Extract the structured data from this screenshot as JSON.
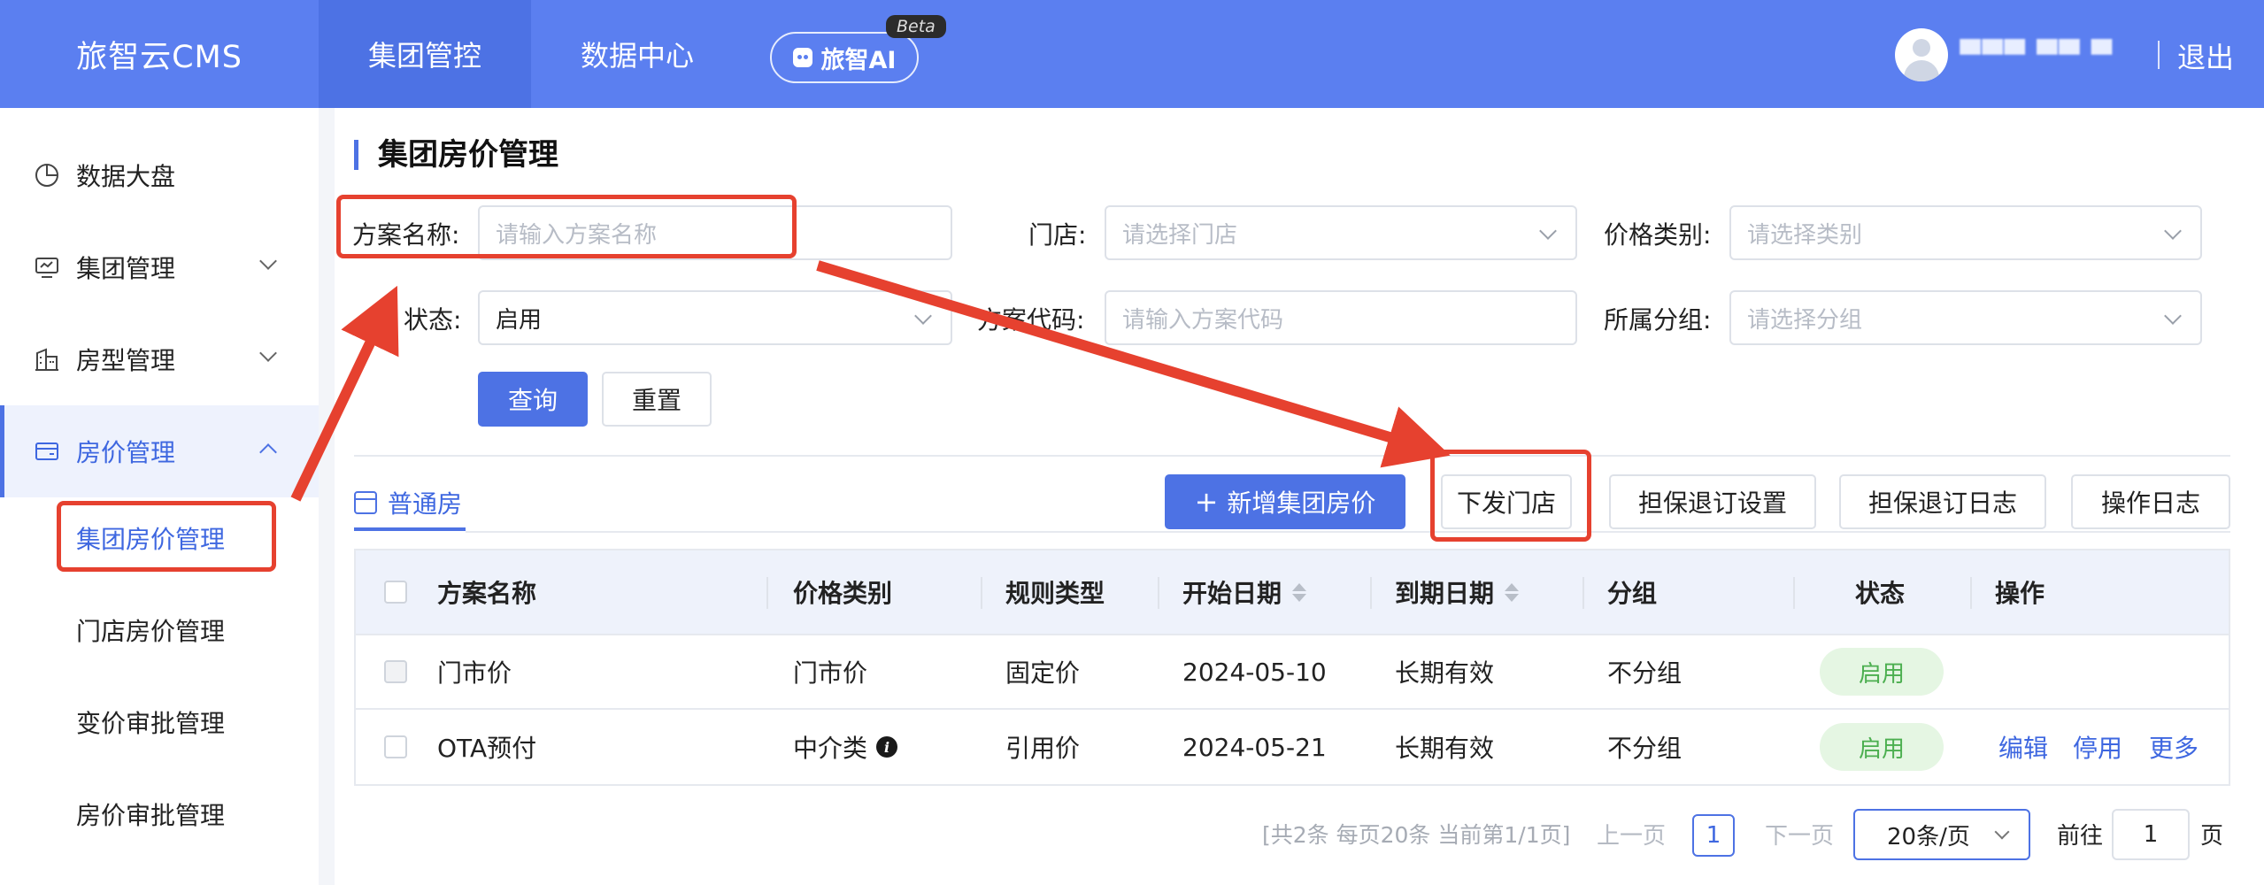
{
  "header": {
    "brand": "旅智云CMS",
    "nav": [
      {
        "label": "集团管控",
        "active": true
      },
      {
        "label": "数据中心",
        "active": false
      }
    ],
    "ai_button": "旅智AI",
    "ai_badge": "Beta",
    "username": "▀▀▀ ▀▀ ▀",
    "logout": "退出"
  },
  "sidebar": {
    "items": [
      {
        "label": "数据大盘",
        "icon": "pie-chart-icon"
      },
      {
        "label": "集团管理",
        "icon": "monitor-icon"
      },
      {
        "label": "房型管理",
        "icon": "building-icon"
      },
      {
        "label": "房价管理",
        "icon": "wallet-icon"
      }
    ],
    "sub_items": [
      {
        "label": "集团房价管理",
        "active": true
      },
      {
        "label": "门店房价管理"
      },
      {
        "label": "变价审批管理"
      },
      {
        "label": "房价审批管理"
      }
    ]
  },
  "page": {
    "title": "集团房价管理"
  },
  "filters": {
    "plan_name": {
      "label": "方案名称:",
      "placeholder": "请输入方案名称"
    },
    "store": {
      "label": "门店:",
      "placeholder": "请选择门店"
    },
    "price_type": {
      "label": "价格类别:",
      "placeholder": "请选择类别"
    },
    "status": {
      "label": "状态:",
      "value": "启用"
    },
    "plan_code": {
      "label": "方案代码:",
      "placeholder": "请输入方案代码"
    },
    "group": {
      "label": "所属分组:",
      "placeholder": "请选择分组"
    },
    "search_button": "查询",
    "reset_button": "重置"
  },
  "toolbar": {
    "tab": "普通房",
    "add_button": "新增集团房价",
    "dispatch_button": "下发门店",
    "guarantee_settings_button": "担保退订设置",
    "guarantee_log_button": "担保退订日志",
    "operation_log_button": "操作日志"
  },
  "table": {
    "columns": [
      "方案名称",
      "价格类别",
      "规则类型",
      "开始日期",
      "到期日期",
      "分组",
      "状态",
      "操作"
    ],
    "rows": [
      {
        "name": "门市价",
        "price_type": "门市价",
        "rule_type": "固定价",
        "start": "2024-05-10",
        "end": "长期有效",
        "group": "不分组",
        "status": "启用",
        "actions": []
      },
      {
        "name": "OTA预付",
        "price_type": "中介类",
        "rule_type": "引用价",
        "start": "2024-05-21",
        "end": "长期有效",
        "group": "不分组",
        "status": "启用",
        "actions": [
          "编辑",
          "停用",
          "更多"
        ]
      }
    ]
  },
  "pagination": {
    "summary": "[共2条 每页20条 当前第1/1页]",
    "prev": "上一页",
    "current": "1",
    "next": "下一页",
    "page_size": "20条/页",
    "goto_label": "前往",
    "goto_value": "1",
    "page_suffix": "页"
  },
  "colors": {
    "primary": "#5b7ff0",
    "active_blue": "#3e67e0",
    "annotation_red": "#e6412f",
    "status_green": "#4caf50"
  }
}
